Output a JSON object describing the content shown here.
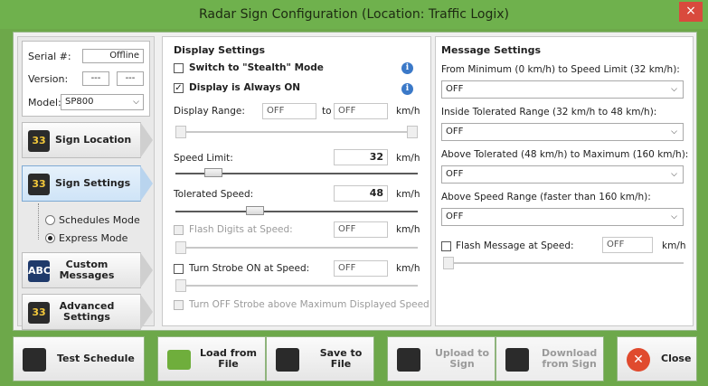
{
  "window": {
    "title": "Radar Sign Configuration (Location: Traffic Logix)",
    "close_glyph": "×"
  },
  "device": {
    "serial_label": "Serial #:",
    "serial_value": "Offline",
    "version_label": "Version:",
    "version_a": "---",
    "version_b": "---",
    "model_label": "Model:",
    "model_value": "SP800"
  },
  "nav": {
    "sign_location": "Sign Location",
    "sign_settings": "Sign Settings",
    "schedules_mode": "Schedules Mode",
    "express_mode": "Express Mode",
    "custom_messages_1": "Custom",
    "custom_messages_2": "Messages",
    "advanced_settings_1": "Advanced",
    "advanced_settings_2": "Settings",
    "icon_glyph": "33"
  },
  "display": {
    "title": "Display Settings",
    "stealth_label": "Switch to \"Stealth\" Mode",
    "always_on_label": "Display is Always ON",
    "info_glyph": "i",
    "range_label": "Display Range:",
    "range_from": "OFF",
    "range_to_label": "to",
    "range_to": "OFF",
    "range_unit": "km/h",
    "speed_limit_label": "Speed Limit:",
    "speed_limit_value": "32",
    "speed_limit_unit": "km/h",
    "tolerated_label": "Tolerated Speed:",
    "tolerated_value": "48",
    "tolerated_unit": "km/h",
    "flash_label": "Flash Digits at Speed:",
    "flash_value": "OFF",
    "flash_unit": "km/h",
    "strobe_label": "Turn Strobe ON at Speed:",
    "strobe_value": "OFF",
    "strobe_unit": "km/h",
    "strobe_off_label": "Turn OFF Strobe above Maximum Displayed Speed"
  },
  "message": {
    "title": "Message Settings",
    "from_min_label": "From Minimum (0 km/h) to Speed Limit (32 km/h):",
    "from_min_value": "OFF",
    "inside_label": "Inside Tolerated Range (32 km/h to 48 km/h):",
    "inside_value": "OFF",
    "above_label": "Above Tolerated (48 km/h) to Maximum (160 km/h):",
    "above_value": "OFF",
    "above_range_label": "Above Speed Range (faster than 160 km/h):",
    "above_range_value": "OFF",
    "flash_msg_label": "Flash Message at Speed:",
    "flash_msg_value": "OFF",
    "flash_msg_unit": "km/h"
  },
  "buttons": {
    "test_schedule": "Test Schedule",
    "load_1": "Load from",
    "load_2": "File",
    "save": "Save to File",
    "upload_1": "Upload to",
    "upload_2": "Sign",
    "download_1": "Download",
    "download_2": "from Sign",
    "close": "Close",
    "close_glyph": "✕"
  },
  "colors": {
    "titlebar": "#6fb14d",
    "accent_blue": "#3b79c8",
    "close_red": "#d94a3d"
  }
}
